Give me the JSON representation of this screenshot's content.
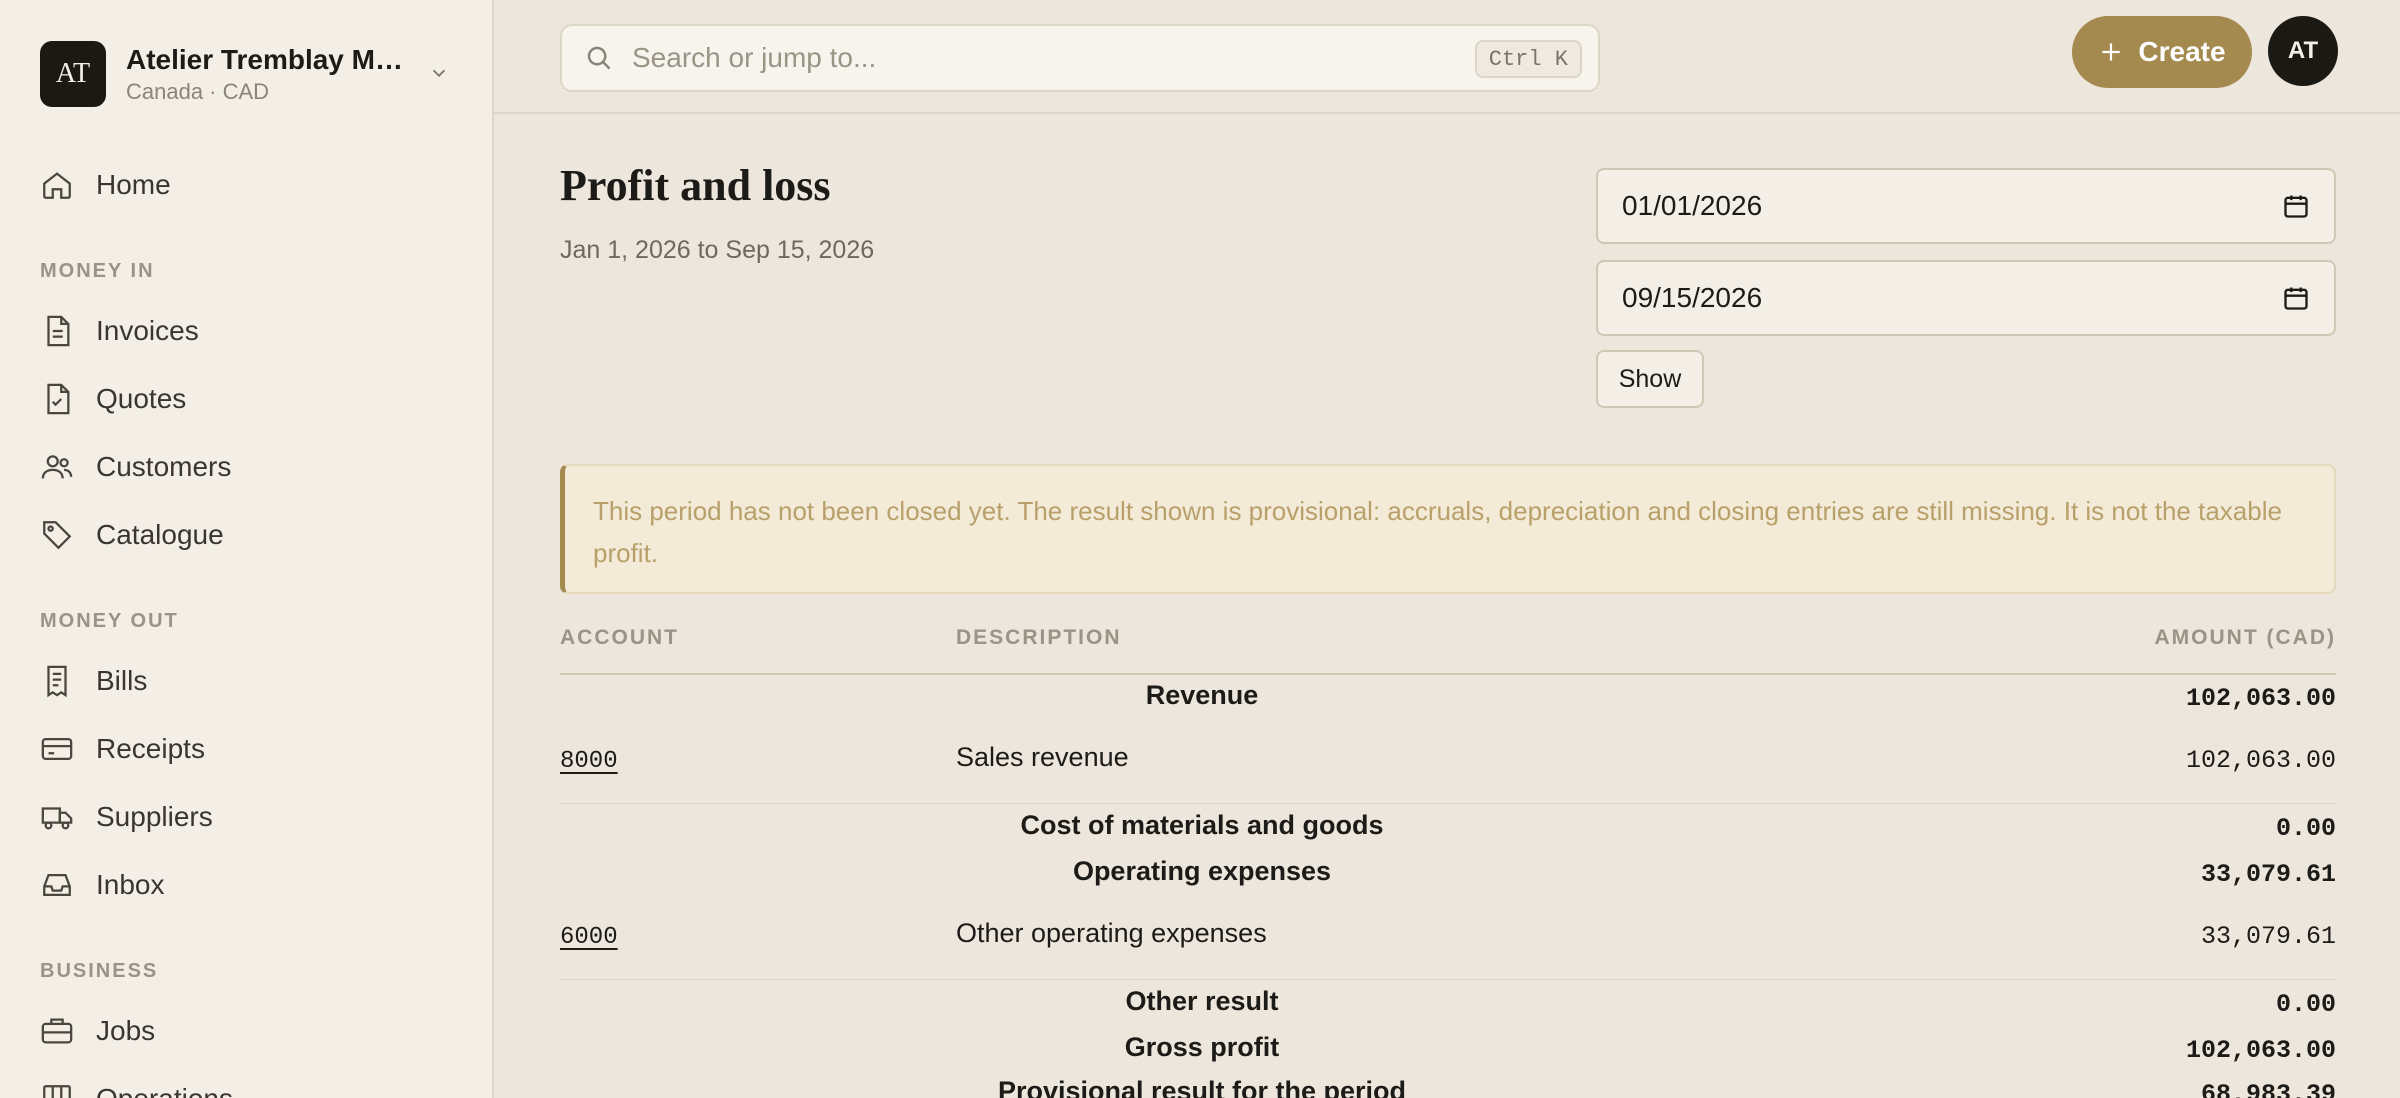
{
  "org": {
    "initials": "AT",
    "name": "Atelier Tremblay Mé…",
    "subtitle": "Canada · CAD"
  },
  "sidebar": {
    "home": "Home",
    "money_in_label": "MONEY IN",
    "money_in": [
      "Invoices",
      "Quotes",
      "Customers",
      "Catalogue"
    ],
    "money_out_label": "MONEY OUT",
    "money_out": [
      "Bills",
      "Receipts",
      "Suppliers",
      "Inbox"
    ],
    "business_label": "BUSINESS",
    "business": [
      "Jobs",
      "Operations"
    ]
  },
  "topbar": {
    "search_placeholder": "Search or jump to...",
    "shortcut": "Ctrl K",
    "create_label": "Create",
    "avatar_initials": "AT"
  },
  "report": {
    "title": "Profit and loss",
    "period": "Jan 1, 2026 to Sep 15, 2026",
    "start_date": "01/01/2026",
    "end_date": "09/15/2026",
    "show_label": "Show",
    "notice": "This period has not been closed yet. The result shown is provisional: accruals, depreciation and closing entries are still missing. It is not the taxable profit.",
    "columns": {
      "account": "ACCOUNT",
      "description": "DESCRIPTION",
      "amount": "AMOUNT (CAD)"
    },
    "rows": [
      {
        "type": "group",
        "label": "Revenue",
        "amount": "102,063.00"
      },
      {
        "type": "line",
        "account": "8000",
        "description": "Sales revenue",
        "amount": "102,063.00"
      },
      {
        "type": "group",
        "label": "Cost of materials and goods",
        "amount": "0.00"
      },
      {
        "type": "group",
        "label": "Operating expenses",
        "amount": "33,079.61"
      },
      {
        "type": "line",
        "account": "6000",
        "description": "Other operating expenses",
        "amount": "33,079.61"
      },
      {
        "type": "group",
        "label": "Other result",
        "amount": "0.00"
      },
      {
        "type": "group",
        "label": "Gross profit",
        "amount": "102,063.00"
      },
      {
        "type": "group",
        "label": "Provisional result for the period",
        "amount": "68,983.39"
      }
    ]
  }
}
